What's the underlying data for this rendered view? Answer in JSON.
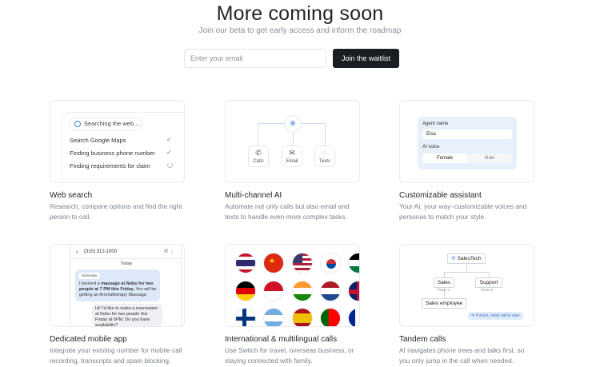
{
  "hero": {
    "title": "More coming soon",
    "subtitle": "Join our beta to get early access and inform the roadmap",
    "email_placeholder": "Enter your email",
    "cta_label": "Join the waitlist"
  },
  "features": [
    {
      "title": "Web search",
      "desc1": "Research, compare options and find the right",
      "desc2": "person to call.",
      "preview": {
        "search_label": "Searching the web....",
        "items": [
          "Search Google Maps",
          "Finding business phone number",
          "Finding requirements for claim"
        ],
        "status_icons": [
          "check-icon",
          "check-icon",
          "spinner-icon"
        ]
      }
    },
    {
      "title": "Multi-channel AI",
      "desc1": "Automate not only calls but also email and",
      "desc2": "texts to handle even more complex tasks.",
      "preview": {
        "channels": [
          "Calls",
          "Email",
          "Texts"
        ],
        "icons": [
          "phone-icon",
          "mail-icon",
          "chat-icon"
        ]
      }
    },
    {
      "title": "Customizable assistant",
      "desc1": "Your AI, your way–customizable voices and",
      "desc2": "personas to match your style.",
      "preview": {
        "name_label": "Agent name",
        "name_value": "Elsa",
        "voice_label": "AI voice",
        "voice_options": [
          "Female",
          "Male"
        ],
        "selected_voice": "Female"
      }
    },
    {
      "title": "Dedicated mobile app",
      "desc1": "Integrate your existing number for mobile call",
      "desc2": "recording, transcripts and spam blocking.",
      "preview": {
        "phone_number": "(310) 312-1000",
        "day_label": "Today",
        "summary_tag": "Summary",
        "message1_a": "I booked a ",
        "message1_b": "massage at Nobu for two people at 7 PM this Friday.",
        "message1_c": " You will be getting an Aromatherapy Massage.",
        "message2": "Hi! I'd like to make a reservation at Nobu for two people this Friday at 6PM. Do you have availability?"
      }
    },
    {
      "title": "International & multilingual calls",
      "desc1": "Use Switch for travel, overseas business, or",
      "desc2": "staying connected with family.",
      "preview": {
        "flags": [
          "thailand",
          "china",
          "usa",
          "south-korea",
          "jordan",
          "germany",
          "indonesia",
          "india",
          "netherlands",
          "uk",
          "finland",
          "argentina",
          "spain",
          "portugal",
          "france"
        ]
      }
    },
    {
      "title": "Tandem calls",
      "desc1": "AI navigates phone trees and talks first, so",
      "desc2": "you only jump in the call when needed.",
      "preview": {
        "root": "SalesTech",
        "branches": [
          "Sales",
          "Support"
        ],
        "press_labels": [
          "Press 1",
          "Press 0"
        ],
        "leaf": "Sales employee",
        "tip": "If stuck, send call to user"
      }
    }
  ],
  "colors": {
    "accent": "#3b7bd6",
    "cta_bg": "#1a1d21",
    "panel_blue": "#e7f0fb"
  }
}
